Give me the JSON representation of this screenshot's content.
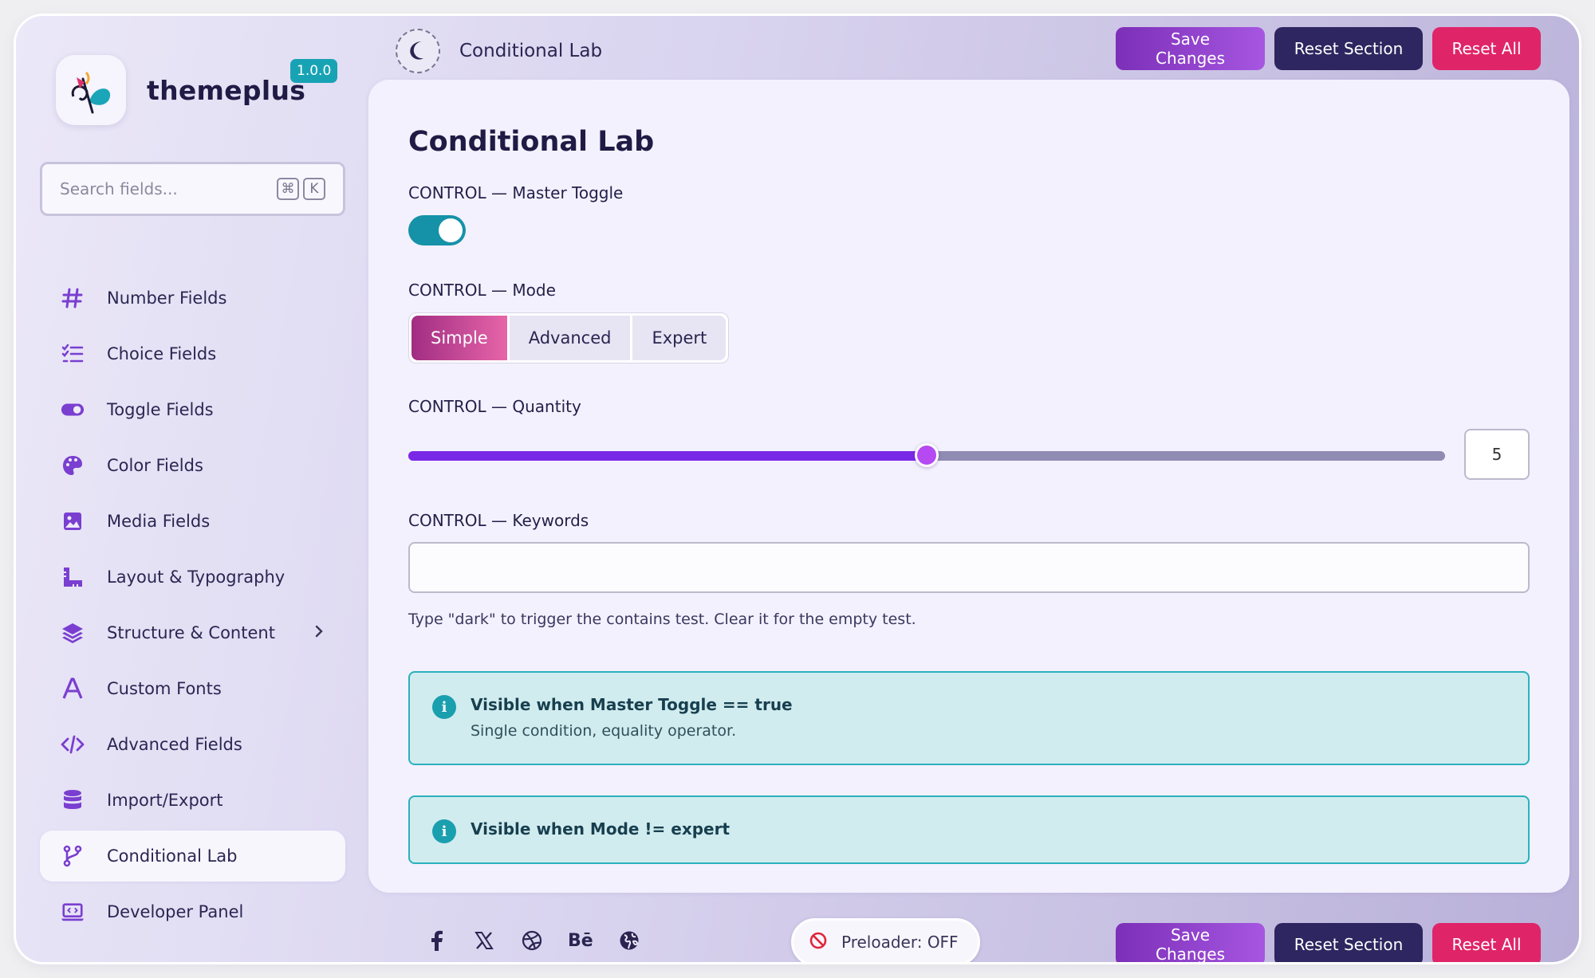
{
  "brand": {
    "name": "themeplus",
    "version": "1.0.0"
  },
  "search": {
    "placeholder": "Search fields...",
    "shortcut_keys": [
      "⌘",
      "K"
    ]
  },
  "sidebar": {
    "items": [
      {
        "label": "Number Fields",
        "icon": "hash-icon"
      },
      {
        "label": "Choice Fields",
        "icon": "checklist-icon"
      },
      {
        "label": "Toggle Fields",
        "icon": "toggle-icon"
      },
      {
        "label": "Color Fields",
        "icon": "palette-icon"
      },
      {
        "label": "Media Fields",
        "icon": "image-icon"
      },
      {
        "label": "Layout & Typography",
        "icon": "ruler-icon"
      },
      {
        "label": "Structure & Content",
        "icon": "layers-icon",
        "has_submenu": true
      },
      {
        "label": "Custom Fonts",
        "icon": "font-icon"
      },
      {
        "label": "Advanced Fields",
        "icon": "code-icon"
      },
      {
        "label": "Import/Export",
        "icon": "database-icon"
      },
      {
        "label": "Conditional Lab",
        "icon": "branch-icon",
        "active": true
      },
      {
        "label": "Developer Panel",
        "icon": "laptop-code-icon"
      }
    ]
  },
  "header": {
    "title": "Conditional Lab",
    "theme_icon": "moon-icon",
    "save_label": "Save Changes",
    "reset_section_label": "Reset Section",
    "reset_all_label": "Reset All"
  },
  "main": {
    "title": "Conditional Lab",
    "master_toggle": {
      "label": "CONTROL — Master Toggle",
      "value": true
    },
    "mode": {
      "label": "CONTROL — Mode",
      "options": [
        "Simple",
        "Advanced",
        "Expert"
      ],
      "selected": "Simple"
    },
    "quantity": {
      "label": "CONTROL — Quantity",
      "value": "5",
      "min": 0,
      "max": 10
    },
    "keywords": {
      "label": "CONTROL — Keywords",
      "value": "",
      "help": "Type \"dark\" to trigger the contains test. Clear it for the empty test."
    },
    "notices": [
      {
        "title": "Visible when Master Toggle == true",
        "text": "Single condition, equality operator."
      },
      {
        "title": "Visible when Mode != expert",
        "text": ""
      }
    ]
  },
  "footer": {
    "social_icons": [
      "facebook-icon",
      "x-icon",
      "dribbble-icon",
      "behance-icon",
      "globe-icon"
    ],
    "behance_text": "Bē",
    "preloader_label": "Preloader: OFF",
    "save_label": "Save Changes",
    "reset_section_label": "Reset Section",
    "reset_all_label": "Reset All"
  },
  "colors": {
    "accent_purple": "#7a28e8",
    "teal": "#1592a8",
    "dark_navy": "#2e2660",
    "pink_red": "#e02468"
  }
}
